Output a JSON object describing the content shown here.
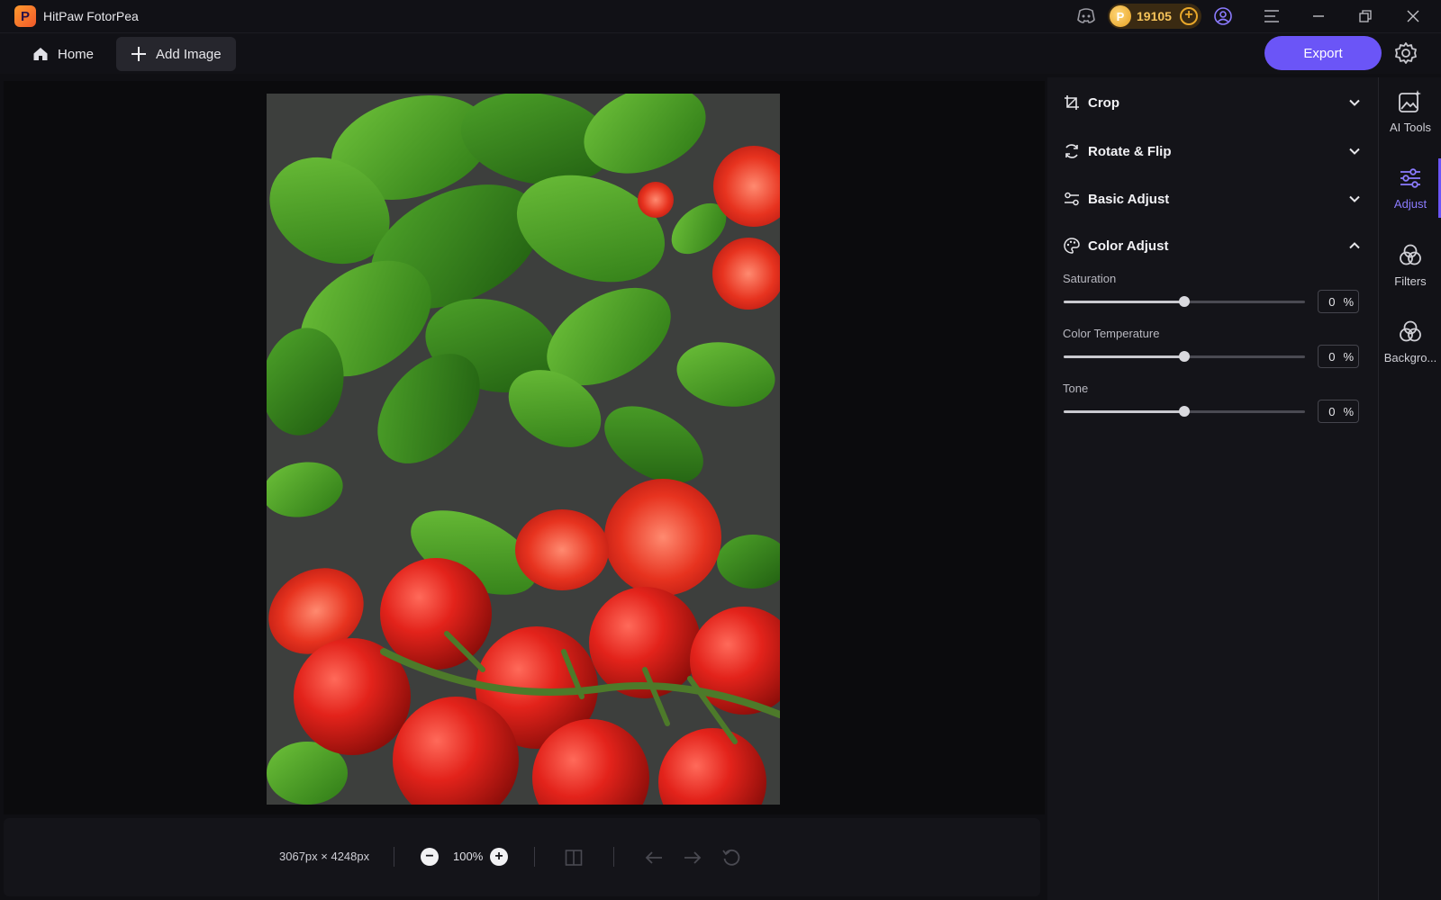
{
  "window": {
    "app_title": "HitPaw FotorPea",
    "logo_letter": "P",
    "coins": "19105"
  },
  "toolbar": {
    "home_label": "Home",
    "add_image_label": "Add Image",
    "export_label": "Export"
  },
  "panel": {
    "sections": [
      {
        "label": "Crop",
        "expanded": false
      },
      {
        "label": "Rotate & Flip",
        "expanded": false
      },
      {
        "label": "Basic Adjust",
        "expanded": false
      },
      {
        "label": "Color Adjust",
        "expanded": true
      }
    ],
    "sliders": [
      {
        "label": "Saturation",
        "value": "0",
        "unit": "%",
        "level": 0.5
      },
      {
        "label": "Color Temperature",
        "value": "0",
        "unit": "%",
        "level": 0.5
      },
      {
        "label": "Tone",
        "value": "0",
        "unit": "%",
        "level": 0.5
      }
    ]
  },
  "sidenav": {
    "items": [
      {
        "label": "AI Tools",
        "icon": "ai-tools-icon",
        "active": false
      },
      {
        "label": "Adjust",
        "icon": "adjust-icon",
        "active": true
      },
      {
        "label": "Filters",
        "icon": "filters-icon",
        "active": false
      },
      {
        "label": "Backgro...",
        "icon": "background-icon",
        "active": false
      }
    ]
  },
  "status": {
    "dimensions": "3067px × 4248px",
    "zoom": "100%"
  },
  "colors": {
    "accent": "#6b55f7",
    "active_text": "#8b7bff",
    "coin": "#f5c35a"
  }
}
